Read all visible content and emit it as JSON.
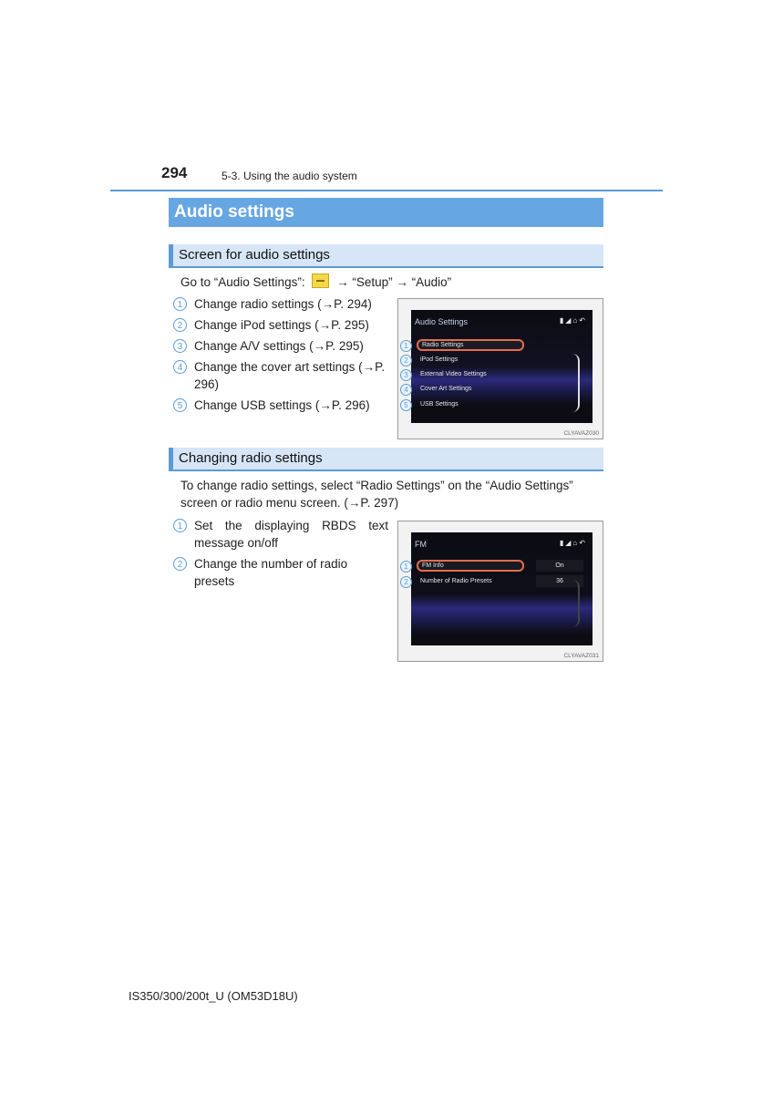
{
  "header": {
    "page_number": "294",
    "chapter": "5-3. Using the audio system"
  },
  "section_title": "Audio settings",
  "screen_for_audio": {
    "heading": "Screen for audio settings",
    "goto_prefix": "Go to “Audio Settings”:",
    "goto_icon": "menu-button-icon",
    "goto_suffix": "→ “Setup” → “Audio”",
    "items": [
      {
        "num": "1",
        "text": "Change radio settings (→P. 294)"
      },
      {
        "num": "2",
        "text": "Change iPod settings (→P. 295)"
      },
      {
        "num": "3",
        "text": "Change A/V settings (→P. 295)"
      },
      {
        "num": "4",
        "text": "Change the cover art settings (→P. 296)"
      },
      {
        "num": "5",
        "text": "Change USB settings (→P. 296)"
      }
    ],
    "figure": {
      "title": "Audio Settings",
      "status_icons": "▮◢⌂↶",
      "rows": [
        {
          "num": "1",
          "label": "Radio Settings"
        },
        {
          "num": "2",
          "label": "iPod Settings"
        },
        {
          "num": "3",
          "label": "External Video Settings"
        },
        {
          "num": "4",
          "label": "Cover Art Settings"
        },
        {
          "num": "5",
          "label": "USB Settings"
        }
      ],
      "code": "CLYAVAZ030"
    }
  },
  "changing_radio": {
    "heading": "Changing radio settings",
    "intro": "To change radio settings, select “Radio Settings” on the “Audio Settings” screen or radio menu screen. (→P. 297)",
    "items": [
      {
        "num": "1",
        "text": "Set the displaying RBDS text message on/off"
      },
      {
        "num": "2",
        "text": "Change the number of radio presets"
      }
    ],
    "figure": {
      "title": "FM",
      "status_icons": "▮◢⌂↶",
      "rows": [
        {
          "num": "1",
          "label": "FM Info",
          "value": "On"
        },
        {
          "num": "2",
          "label": "Number of Radio Presets",
          "value": "36"
        }
      ],
      "code": "CLYAVAZ031"
    }
  },
  "footer": "IS350/300/200t_U (OM53D18U)",
  "colors": {
    "accent_blue": "#5b9bd5",
    "title_bar": "#66a6e3",
    "subheading_bg": "#d6e6f6",
    "highlight": "#e86b4d"
  }
}
